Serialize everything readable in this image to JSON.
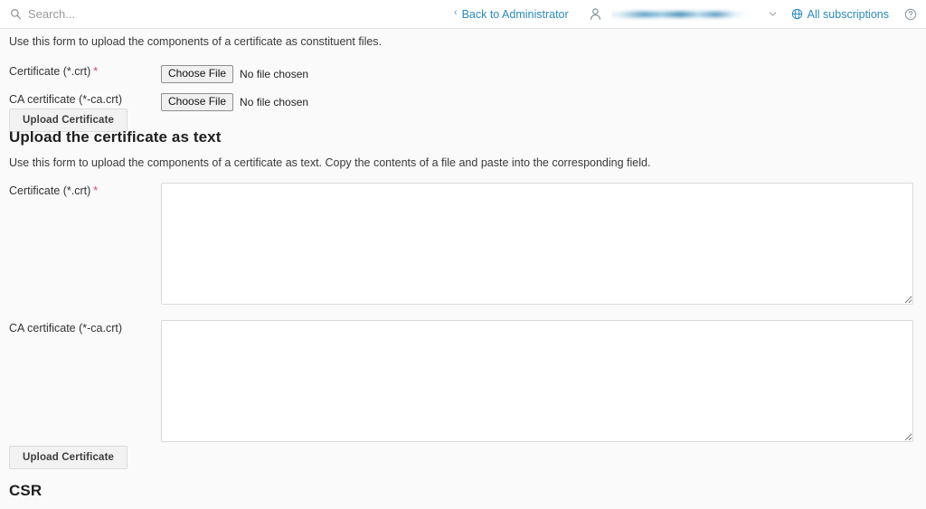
{
  "header": {
    "search": {
      "icon": "search-icon",
      "placeholder": "Search...",
      "value": ""
    },
    "back_link": {
      "chevron": "‹",
      "label": "Back to Administrator"
    },
    "user_icon": "person-icon",
    "user_name_redacted": "",
    "user_chevron_icon": "chevron-down-icon",
    "subscriptions": {
      "icon": "globe-icon",
      "label": "All subscriptions"
    },
    "help_icon": "help-circle-icon",
    "link_color": "#2b8aba"
  },
  "sidebar": {
    "handle_label": "",
    "handle_color": "#e2e2e2"
  },
  "file_upload_form": {
    "description": "Use this form to upload the components of a certificate as constituent files.",
    "fields": [
      {
        "label": "Certificate (*.crt)",
        "required": true,
        "required_marker": "*",
        "button_label": "Choose File",
        "status_text": "No file chosen"
      },
      {
        "label": "CA certificate (*-ca.crt)",
        "required": false,
        "required_marker": "",
        "button_label": "Choose File",
        "status_text": "No file chosen"
      }
    ],
    "submit_label": "Upload Certificate"
  },
  "text_upload_form": {
    "title": "Upload the certificate as text",
    "description": "Use this form to upload the components of a certificate as text. Copy the contents of a file and paste into the corresponding field.",
    "fields": [
      {
        "label": "Certificate (*.crt)",
        "required": true,
        "required_marker": "*",
        "value": "",
        "placeholder": ""
      },
      {
        "label": "CA certificate (*-ca.crt)",
        "required": false,
        "required_marker": "",
        "value": "",
        "placeholder": ""
      }
    ],
    "submit_label": "Upload Certificate"
  },
  "csr_section": {
    "title": "CSR"
  },
  "colors": {
    "page_background": "#fafafa",
    "header_background": "#ffffff",
    "accent_link": "#2b8aba",
    "required_star": "#d9455f",
    "border": "#dadada"
  }
}
